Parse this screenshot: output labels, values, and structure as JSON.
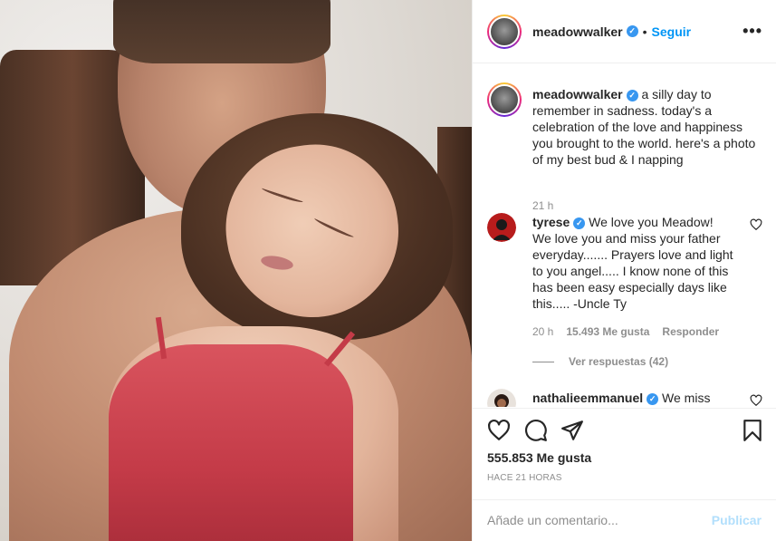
{
  "post": {
    "username": "meadowwalker",
    "follow_label": "Seguir",
    "dot": "•",
    "more_label": "•••",
    "verified_mark": "✓"
  },
  "caption": {
    "username": "meadowwalker",
    "text": "a silly day to remember in sadness. today's a celebration of the love and happiness you brought to the world. here's a photo of my best bud & I napping",
    "time": "21 h"
  },
  "comments": [
    {
      "username": "tyrese",
      "text": "We love you Meadow! We love you and miss your father everyday....... Prayers love and light to you angel..... I know none of this has been easy especially days like this..... -Uncle Ty",
      "time": "20 h",
      "likes": "15.493 Me gusta",
      "reply_label": "Responder",
      "view_replies": "Ver respuestas (42)"
    },
    {
      "username": "nathalieemmanuel",
      "text": "We miss"
    }
  ],
  "actions": {
    "likes": "555.853 Me gusta",
    "time": "HACE 21 HORAS",
    "icons": [
      "heart-icon",
      "comment-icon",
      "share-icon",
      "bookmark-icon"
    ]
  },
  "comment_box": {
    "placeholder": "Añade un comentario...",
    "post_label": "Publicar"
  },
  "colors": {
    "link": "#0095f6",
    "verified": "#3897f0",
    "muted": "#8e8e8e",
    "post_disabled": "#b2dffc"
  }
}
